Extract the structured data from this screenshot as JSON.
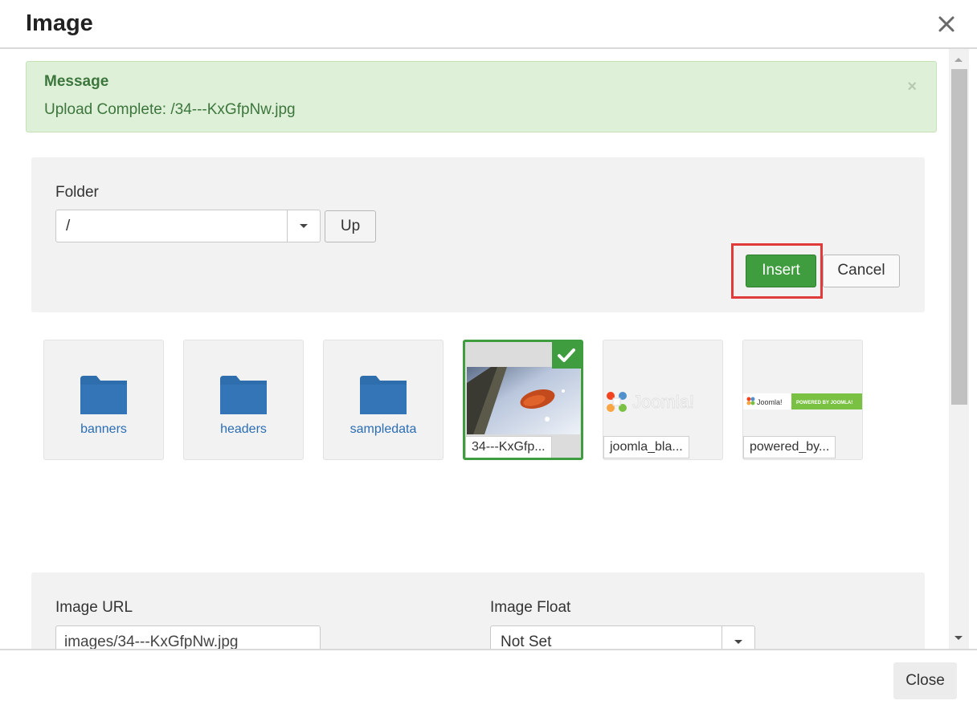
{
  "dialog": {
    "title": "Image",
    "close_icon": "close-icon"
  },
  "alert": {
    "heading": "Message",
    "text": "Upload Complete: /34---KxGfpNw.jpg",
    "close_glyph": "×",
    "color": "#3c763d",
    "background": "#dff0d8"
  },
  "folder_panel": {
    "label": "Folder",
    "selected": "/",
    "up_label": "Up",
    "insert_label": "Insert",
    "cancel_label": "Cancel"
  },
  "media": {
    "folders": [
      {
        "name": "banners",
        "icon": "folder-icon"
      },
      {
        "name": "headers",
        "icon": "folder-icon"
      },
      {
        "name": "sampledata",
        "icon": "folder-icon"
      }
    ],
    "images": [
      {
        "name": "34---KxGfp...",
        "selected": true
      },
      {
        "name": "joomla_bla...",
        "selected": false
      },
      {
        "name": "powered_by...",
        "selected": false
      }
    ]
  },
  "image_props": {
    "url_label": "Image URL",
    "url_value": "images/34---KxGfpNw.jpg",
    "float_label": "Image Float",
    "float_value": "Not Set"
  },
  "footer": {
    "close_label": "Close"
  },
  "colors": {
    "accent_green": "#3f9c3f",
    "highlight_red": "#e03a3a",
    "folder_blue": "#2a6db3"
  }
}
